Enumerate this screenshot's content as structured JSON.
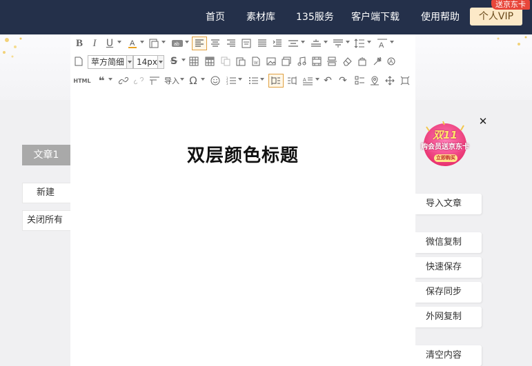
{
  "nav": {
    "items": [
      "首页",
      "素材库",
      "135服务",
      "客户端下载",
      "使用帮助"
    ],
    "vip_label": "个人VIP",
    "vip_badge": "送京东卡"
  },
  "toolbar": {
    "font_family": "苹方简细",
    "font_size": "14px",
    "html_label": "HTML",
    "import_label": "导入"
  },
  "left_panel": {
    "tab_label": "文章1",
    "new_label": "新建",
    "close_all_label": "关闭所有"
  },
  "editor": {
    "title": "双层颜色标题"
  },
  "right_panel": {
    "import_label": "导入文章",
    "wechat_copy_label": "微信复制",
    "quick_save_label": "快速保存",
    "save_sync_label": "保存同步",
    "external_copy_label": "外网复制",
    "clear_label": "清空内容"
  },
  "promo": {
    "line1": "双11",
    "line2": "购会员送京东卡",
    "button": "立即购买",
    "close": "✕"
  },
  "colors": {
    "topbar": "#24304a",
    "vip_bg": "#fce9c8",
    "badge": "#e8463a",
    "active_tool_border": "#e0a040"
  }
}
